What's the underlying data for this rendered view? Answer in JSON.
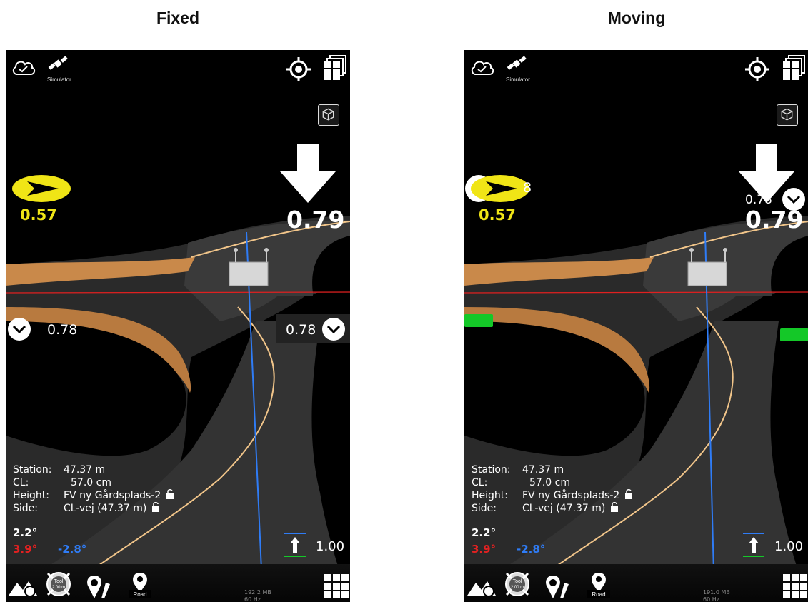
{
  "titles": {
    "left": "Fixed",
    "right": "Moving"
  },
  "top_bar": {
    "sim_label": "Simulator",
    "icons": [
      "cloud-check-icon",
      "satellite-icon",
      "target-icon",
      "layers-icon",
      "cube-icon"
    ]
  },
  "fixed": {
    "big_value": "0.79",
    "yellow_value": "0.57",
    "left_value": "0.78",
    "right_value": "0.78",
    "info": {
      "station_key": "Station:",
      "station_val": "47.37 m",
      "cl_key": "CL:",
      "cl_val": "57.0 cm",
      "height_key": "Height:",
      "height_val": "FV ny Gårdsplads-2",
      "side_key": "Side:",
      "side_val": "CL-vej (47.37 m)"
    },
    "slope_top": "2.2°",
    "slope_red": "3.9°",
    "slope_blue": "-2.8°",
    "scale_value": "1.00",
    "tool_label_1": "Tool",
    "tool_label_2": "2.00 m",
    "road_label": "Road",
    "mem_line1": "192.2 MB",
    "mem_line2": "60 Hz"
  },
  "moving": {
    "big_value": "0.79",
    "overlap_value": "0.78",
    "yellow_value": "0.57",
    "yellow_overlap_value": "8",
    "info": {
      "station_key": "Station:",
      "station_val": "47.37 m",
      "cl_key": "CL:",
      "cl_val": "57.0 cm",
      "height_key": "Height:",
      "height_val": "FV ny Gårdsplads-2",
      "side_key": "Side:",
      "side_val": "CL-vej (47.37 m)"
    },
    "slope_top": "2.2°",
    "slope_red": "3.9°",
    "slope_blue": "-2.8°",
    "scale_value": "1.00",
    "tool_label_1": "Tool",
    "tool_label_2": "2.00 m",
    "road_label": "Road",
    "mem_line1": "191.0 MB",
    "mem_line2": "60 Hz"
  },
  "colors": {
    "yellow": "#f0e516",
    "red": "#e22121",
    "blue": "#2f7cf6",
    "green_marker": "#14c828",
    "road_edge_tan": "#c9894a"
  }
}
